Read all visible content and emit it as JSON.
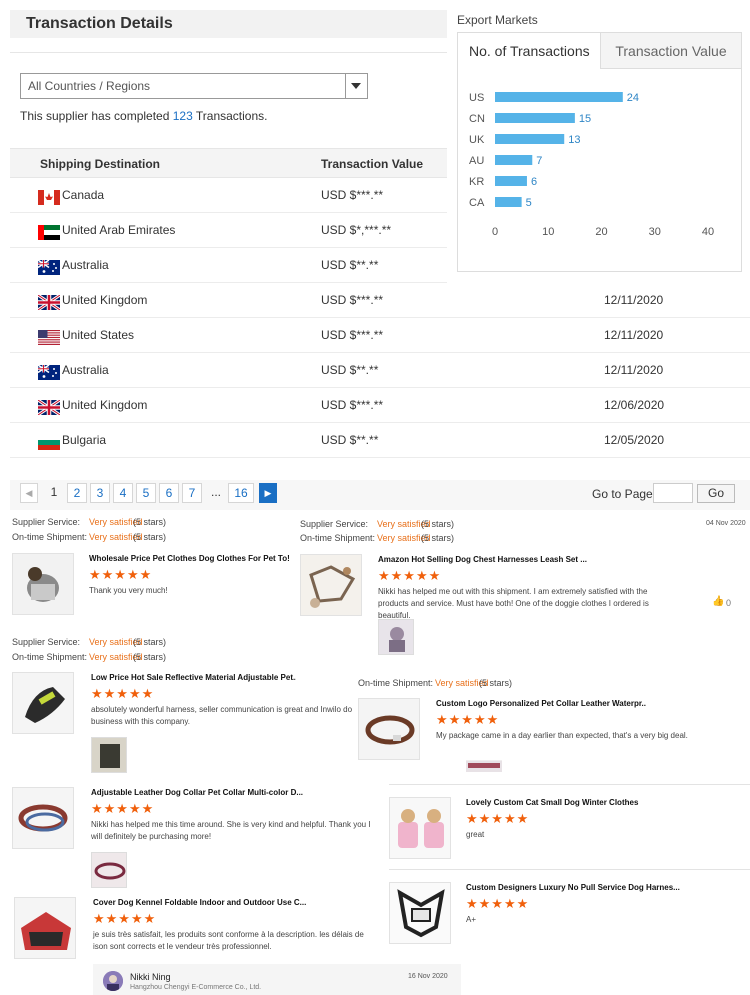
{
  "transaction": {
    "title": "Transaction Details",
    "country_select": "All Countries / Regions",
    "completed_prefix": "This supplier has completed ",
    "completed_count": "123",
    "completed_suffix": " Transactions.",
    "headers": {
      "destination": "Shipping Destination",
      "value": "Transaction Value"
    },
    "rows": [
      {
        "flag": "canada-flag-icon",
        "country": "Canada",
        "value": "USD $***.**",
        "date": ""
      },
      {
        "flag": "uae-flag-icon",
        "country": "United Arab Emirates",
        "value": "USD $*,***.**",
        "date": ""
      },
      {
        "flag": "australia-flag-icon",
        "country": "Australia",
        "value": "USD $**.**",
        "date": ""
      },
      {
        "flag": "uk-flag-icon",
        "country": "United Kingdom",
        "value": "USD $***.**",
        "date": "12/11/2020"
      },
      {
        "flag": "us-flag-icon",
        "country": "United States",
        "value": "USD $***.**",
        "date": "12/11/2020"
      },
      {
        "flag": "australia-flag-icon",
        "country": "Australia",
        "value": "USD $**.**",
        "date": "12/11/2020"
      },
      {
        "flag": "uk-flag-icon",
        "country": "United Kingdom",
        "value": "USD $***.**",
        "date": "12/06/2020"
      },
      {
        "flag": "bulgaria-flag-icon",
        "country": "Bulgaria",
        "value": "USD $**.**",
        "date": "12/05/2020"
      }
    ],
    "pagination": {
      "pages": [
        "1",
        "2",
        "3",
        "4",
        "5",
        "6",
        "7"
      ],
      "ellipsis": "...",
      "last": "16",
      "goto_label": "Go to Page",
      "go_button": "Go"
    }
  },
  "export_markets": {
    "label": "Export Markets",
    "tabs": [
      "No. of Transactions",
      "Transaction Value"
    ],
    "bar_color": "#55b3e8"
  },
  "chart_data": {
    "type": "bar",
    "orientation": "horizontal",
    "categories": [
      "US",
      "CN",
      "UK",
      "AU",
      "KR",
      "CA"
    ],
    "values": [
      24,
      15,
      13,
      7,
      6,
      5
    ],
    "xlim": [
      0,
      40
    ],
    "xticks": [
      "0",
      "10",
      "20",
      "30",
      "40"
    ],
    "grid": false
  },
  "reviews": {
    "meta_labels": {
      "supplier": "Supplier Service:",
      "ontime": "On-time Shipment:",
      "satisfied": "Very satisfied",
      "stars": "(5 stars)"
    },
    "rating_stars": "★★★★★",
    "items": [
      {
        "title": "Wholesale Price Pet Clothes Dog Clothes For Pet To!",
        "text": "Thank you very much!"
      },
      {
        "title": "Amazon Hot Selling Dog Chest Harnesses Leash Set ...",
        "text": "Nikki has helped me out with this shipment. I am extremely satisfied with the products and service. Must have both! One of the doggie clothes I ordered is beautiful.",
        "date": "04 Nov 2020",
        "likes": "0"
      },
      {
        "title": "Low Price Hot Sale Reflective Material Adjustable Pet...",
        "text": "absolutely wonderful harness, seller communication is great and Inwilo do business with this company."
      },
      {
        "title": "Custom Logo Personalized Pet Collar Leather Waterpr...",
        "text": "My package came in a day earlier than expected, that's a very big deal."
      },
      {
        "title": "Adjustable Leather Dog Collar Pet Collar Multi-color D...",
        "text": "Nikki has helped me this time around. She is  very kind and helpful. Thank you I will definitely be purchasing more!"
      },
      {
        "title": "Lovely Custom Cat Small Dog Winter Clothes",
        "text": "great"
      },
      {
        "title": "Cover Dog Kennel Foldable Indoor and Outdoor Use C...",
        "text": "je suis très satisfait, les produits sont conforme à la description. les délais de ison sont corrects et le vendeur très professionnel."
      },
      {
        "title": "Custom Designers Luxury No Pull Service Dog Harnes...",
        "text": "A+"
      }
    ],
    "reply": {
      "name": "Nikki Ning",
      "company": "Hangzhou Chengyi E-Commerce Co., Ltd.",
      "date": "16 Nov 2020"
    }
  }
}
